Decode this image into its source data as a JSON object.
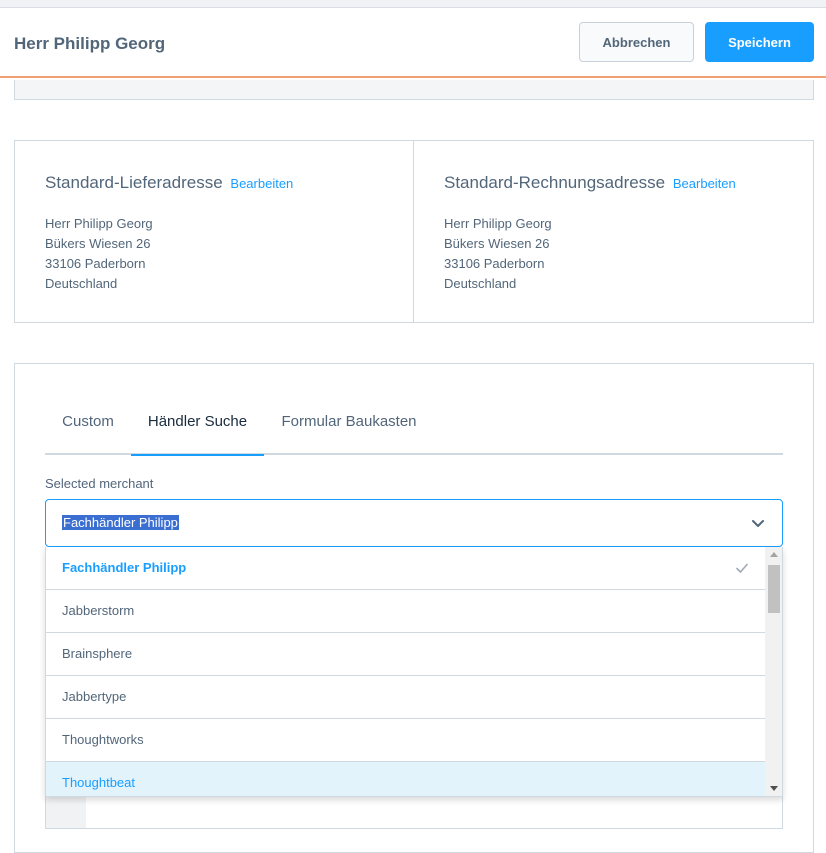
{
  "header": {
    "title": "Herr Philipp Georg",
    "cancel_label": "Abbrechen",
    "save_label": "Speichern"
  },
  "addresses": {
    "shipping": {
      "heading": "Standard-Lieferadresse",
      "edit_label": "Bearbeiten",
      "lines": [
        "Herr Philipp Georg",
        "Bükers Wiesen 26",
        "33106 Paderborn",
        "Deutschland"
      ]
    },
    "billing": {
      "heading": "Standard-Rechnungsadresse",
      "edit_label": "Bearbeiten",
      "lines": [
        "Herr Philipp Georg",
        "Bükers Wiesen 26",
        "33106 Paderborn",
        "Deutschland"
      ]
    }
  },
  "tabs": [
    {
      "label": "Custom"
    },
    {
      "label": "Händler Suche"
    },
    {
      "label": "Formular Baukasten"
    }
  ],
  "merchant": {
    "label": "Selected merchant",
    "value": "Fachhändler Philipp",
    "options": [
      {
        "label": "Fachhändler Philipp"
      },
      {
        "label": "Jabberstorm"
      },
      {
        "label": "Brainsphere"
      },
      {
        "label": "Jabbertype"
      },
      {
        "label": "Thoughtworks"
      },
      {
        "label": "Thoughtbeat"
      }
    ]
  },
  "colors": {
    "accent": "#189eff",
    "header_border": "#f2a077",
    "text": "#52667a",
    "hover_bg": "#e3f3fb"
  },
  "icons": {
    "select_toggle": "chevron-down-icon",
    "selected_option": "check-icon"
  }
}
